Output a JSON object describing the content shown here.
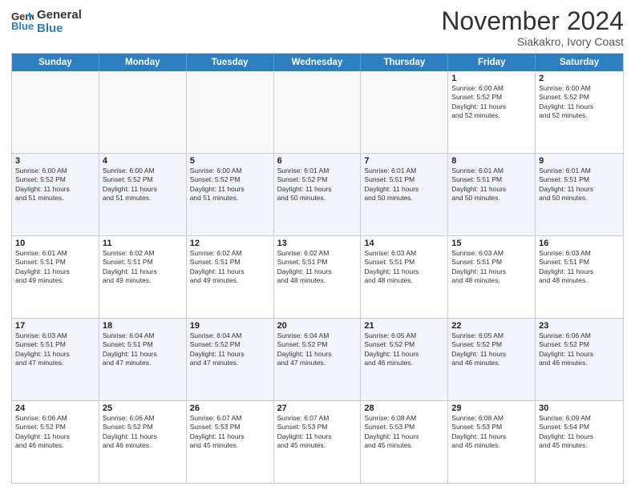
{
  "header": {
    "logo_line1": "General",
    "logo_line2": "Blue",
    "month_title": "November 2024",
    "location": "Siakakro, Ivory Coast"
  },
  "weekdays": [
    "Sunday",
    "Monday",
    "Tuesday",
    "Wednesday",
    "Thursday",
    "Friday",
    "Saturday"
  ],
  "rows": [
    [
      {
        "day": "",
        "info": ""
      },
      {
        "day": "",
        "info": ""
      },
      {
        "day": "",
        "info": ""
      },
      {
        "day": "",
        "info": ""
      },
      {
        "day": "",
        "info": ""
      },
      {
        "day": "1",
        "info": "Sunrise: 6:00 AM\nSunset: 5:52 PM\nDaylight: 11 hours\nand 52 minutes."
      },
      {
        "day": "2",
        "info": "Sunrise: 6:00 AM\nSunset: 5:52 PM\nDaylight: 11 hours\nand 52 minutes."
      }
    ],
    [
      {
        "day": "3",
        "info": "Sunrise: 6:00 AM\nSunset: 5:52 PM\nDaylight: 11 hours\nand 51 minutes."
      },
      {
        "day": "4",
        "info": "Sunrise: 6:00 AM\nSunset: 5:52 PM\nDaylight: 11 hours\nand 51 minutes."
      },
      {
        "day": "5",
        "info": "Sunrise: 6:00 AM\nSunset: 5:52 PM\nDaylight: 11 hours\nand 51 minutes."
      },
      {
        "day": "6",
        "info": "Sunrise: 6:01 AM\nSunset: 5:52 PM\nDaylight: 11 hours\nand 50 minutes."
      },
      {
        "day": "7",
        "info": "Sunrise: 6:01 AM\nSunset: 5:51 PM\nDaylight: 11 hours\nand 50 minutes."
      },
      {
        "day": "8",
        "info": "Sunrise: 6:01 AM\nSunset: 5:51 PM\nDaylight: 11 hours\nand 50 minutes."
      },
      {
        "day": "9",
        "info": "Sunrise: 6:01 AM\nSunset: 5:51 PM\nDaylight: 11 hours\nand 50 minutes."
      }
    ],
    [
      {
        "day": "10",
        "info": "Sunrise: 6:01 AM\nSunset: 5:51 PM\nDaylight: 11 hours\nand 49 minutes."
      },
      {
        "day": "11",
        "info": "Sunrise: 6:02 AM\nSunset: 5:51 PM\nDaylight: 11 hours\nand 49 minutes."
      },
      {
        "day": "12",
        "info": "Sunrise: 6:02 AM\nSunset: 5:51 PM\nDaylight: 11 hours\nand 49 minutes."
      },
      {
        "day": "13",
        "info": "Sunrise: 6:02 AM\nSunset: 5:51 PM\nDaylight: 11 hours\nand 48 minutes."
      },
      {
        "day": "14",
        "info": "Sunrise: 6:03 AM\nSunset: 5:51 PM\nDaylight: 11 hours\nand 48 minutes."
      },
      {
        "day": "15",
        "info": "Sunrise: 6:03 AM\nSunset: 5:51 PM\nDaylight: 11 hours\nand 48 minutes."
      },
      {
        "day": "16",
        "info": "Sunrise: 6:03 AM\nSunset: 5:51 PM\nDaylight: 11 hours\nand 48 minutes."
      }
    ],
    [
      {
        "day": "17",
        "info": "Sunrise: 6:03 AM\nSunset: 5:51 PM\nDaylight: 11 hours\nand 47 minutes."
      },
      {
        "day": "18",
        "info": "Sunrise: 6:04 AM\nSunset: 5:51 PM\nDaylight: 11 hours\nand 47 minutes."
      },
      {
        "day": "19",
        "info": "Sunrise: 6:04 AM\nSunset: 5:52 PM\nDaylight: 11 hours\nand 47 minutes."
      },
      {
        "day": "20",
        "info": "Sunrise: 6:04 AM\nSunset: 5:52 PM\nDaylight: 11 hours\nand 47 minutes."
      },
      {
        "day": "21",
        "info": "Sunrise: 6:05 AM\nSunset: 5:52 PM\nDaylight: 11 hours\nand 46 minutes."
      },
      {
        "day": "22",
        "info": "Sunrise: 6:05 AM\nSunset: 5:52 PM\nDaylight: 11 hours\nand 46 minutes."
      },
      {
        "day": "23",
        "info": "Sunrise: 6:06 AM\nSunset: 5:52 PM\nDaylight: 11 hours\nand 46 minutes."
      }
    ],
    [
      {
        "day": "24",
        "info": "Sunrise: 6:06 AM\nSunset: 5:52 PM\nDaylight: 11 hours\nand 46 minutes."
      },
      {
        "day": "25",
        "info": "Sunrise: 6:06 AM\nSunset: 5:52 PM\nDaylight: 11 hours\nand 46 minutes."
      },
      {
        "day": "26",
        "info": "Sunrise: 6:07 AM\nSunset: 5:53 PM\nDaylight: 11 hours\nand 45 minutes."
      },
      {
        "day": "27",
        "info": "Sunrise: 6:07 AM\nSunset: 5:53 PM\nDaylight: 11 hours\nand 45 minutes."
      },
      {
        "day": "28",
        "info": "Sunrise: 6:08 AM\nSunset: 5:53 PM\nDaylight: 11 hours\nand 45 minutes."
      },
      {
        "day": "29",
        "info": "Sunrise: 6:08 AM\nSunset: 5:53 PM\nDaylight: 11 hours\nand 45 minutes."
      },
      {
        "day": "30",
        "info": "Sunrise: 6:09 AM\nSunset: 5:54 PM\nDaylight: 11 hours\nand 45 minutes."
      }
    ]
  ]
}
